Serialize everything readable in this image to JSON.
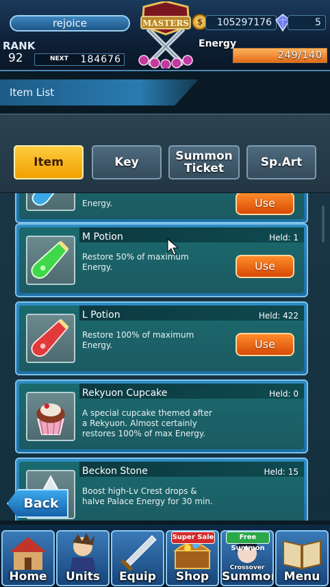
{
  "hud": {
    "player_name": "rejoice",
    "logo_text": "MASTERS",
    "coins": "105297176",
    "gems": "5",
    "rank_label": "RANK",
    "rank_value": "92",
    "next_label": "NEXT",
    "next_value": "184676",
    "energy_label": "Energy",
    "energy_value": "249/140",
    "energy_fill_fraction": 1.0
  },
  "page": {
    "title": "Item List"
  },
  "tabs": [
    {
      "label": "Item",
      "active": true
    },
    {
      "label": "Key",
      "active": false
    },
    {
      "label": "Summon\nTicket",
      "active": false
    },
    {
      "label": "Sp.Art",
      "active": false
    }
  ],
  "items": [
    {
      "name": "",
      "held": "",
      "desc": "Energy.",
      "use_label": "Use",
      "icon": "s-potion-icon"
    },
    {
      "name": "M Potion",
      "held": "Held: 1",
      "desc": "Restore 50% of maximum\nEnergy.",
      "use_label": "Use",
      "icon": "m-potion-icon"
    },
    {
      "name": "L Potion",
      "held": "Held: 422",
      "desc": "Restore 100% of maximum\nEnergy.",
      "use_label": "Use",
      "icon": "l-potion-icon"
    },
    {
      "name": "Rekyuon Cupcake",
      "held": "Held: 0",
      "desc": "A special cupcake themed after\na Rekyuon. Almost certainly\nrestores 100% of max Energy.",
      "use_label": "",
      "icon": "cupcake-icon"
    },
    {
      "name": "Beckon Stone",
      "held": "Held: 15",
      "desc": "Boost high-Lv Crest drops &\nhalve Palace Energy for 30 min.",
      "use_label": "",
      "icon": "beckon-stone-icon"
    }
  ],
  "back_label": "Back",
  "nav": [
    {
      "label": "Home",
      "badge": ""
    },
    {
      "label": "Units",
      "badge": ""
    },
    {
      "label": "Equip",
      "badge": ""
    },
    {
      "label": "Shop",
      "badge": "Super Sale"
    },
    {
      "label": "Summon",
      "badge": "Free Summon",
      "sub": "Crossover"
    },
    {
      "label": "Menu",
      "badge": ""
    }
  ],
  "colors": {
    "accent": "#2f8cc4",
    "active_tab": "#f0a000",
    "use_button": "#d74a06"
  }
}
